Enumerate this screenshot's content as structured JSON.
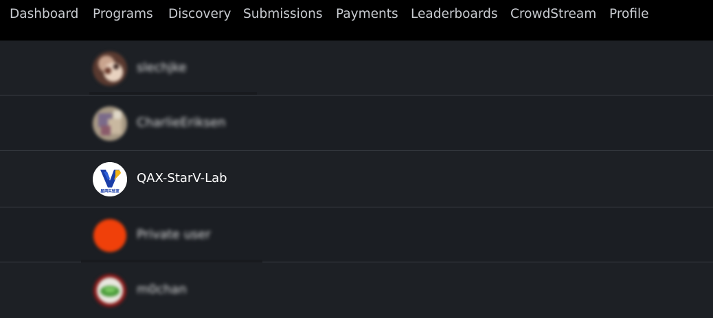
{
  "nav": {
    "items": [
      "Dashboard",
      "Programs",
      "Discovery",
      "Submissions",
      "Payments",
      "Leaderboards",
      "CrowdStream",
      "Profile"
    ]
  },
  "users": [
    {
      "name": "slechjke",
      "blurred": true,
      "avatar_icon": "cartoon-animal-avatar-icon"
    },
    {
      "name": "CharlieEriksen",
      "blurred": true,
      "avatar_icon": "pixelated-photo-avatar-icon"
    },
    {
      "name": "QAX-StarV-Lab",
      "blurred": false,
      "avatar_icon": "starv-lab-logo-avatar-icon",
      "logo_text": "星舆实验室"
    },
    {
      "name": "Private user",
      "blurred": true,
      "avatar_icon": "orange-circle-avatar-icon"
    },
    {
      "name": "m0chan",
      "blurred": true,
      "avatar_icon": "green-leaf-avatar-icon"
    }
  ],
  "colors": {
    "nav_bg": "#000000",
    "nav_text": "#c8cbd0",
    "page_bg": "#1c1f24",
    "divider": "#3b3f46",
    "private_avatar": "#f0400a",
    "starv_blue": "#1a3ea8",
    "starv_yellow": "#f2b417"
  }
}
